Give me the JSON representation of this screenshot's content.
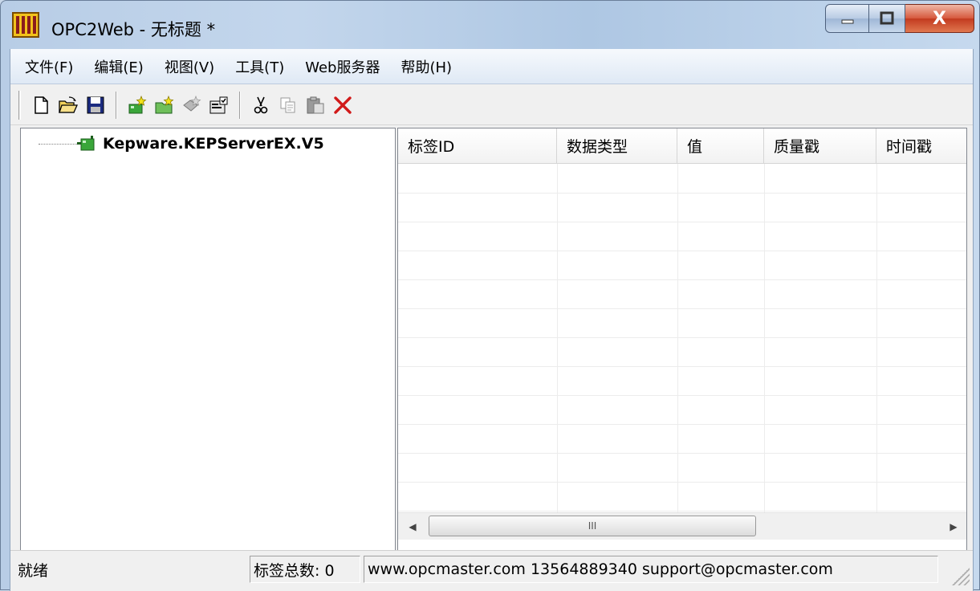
{
  "window": {
    "title": "OPC2Web - 无标题 *",
    "min_label": "—",
    "max_label": "☐",
    "close_label": "X"
  },
  "menu": [
    "文件(F)",
    "编辑(E)",
    "视图(V)",
    "工具(T)",
    "Web服务器",
    "帮助(H)"
  ],
  "toolbar": {
    "buttons": [
      "new-icon",
      "open-icon",
      "save-icon",
      "add-server-icon",
      "add-group-icon",
      "add-item-icon",
      "properties-icon",
      "cut-icon",
      "copy-icon",
      "paste-icon",
      "delete-icon"
    ]
  },
  "tree": {
    "root_label": "Kepware.KEPServerEX.V5"
  },
  "list": {
    "columns": [
      "标签ID",
      "数据类型",
      "值",
      "质量戳",
      "时间戳"
    ],
    "rows": []
  },
  "scrollbar": {
    "thumb_glyph": "III",
    "left_arrow": "◀",
    "right_arrow": "▶"
  },
  "status": {
    "ready": "就绪",
    "tag_count": "标签总数: 0",
    "contact": "www.opcmaster.com 13564889340 support@opcmaster.com"
  },
  "colors": {
    "close_button": "#c23a1f",
    "title_bar": "#b8cde6",
    "delete_icon": "#d11a1a",
    "tree_node": "#3aa63a"
  }
}
